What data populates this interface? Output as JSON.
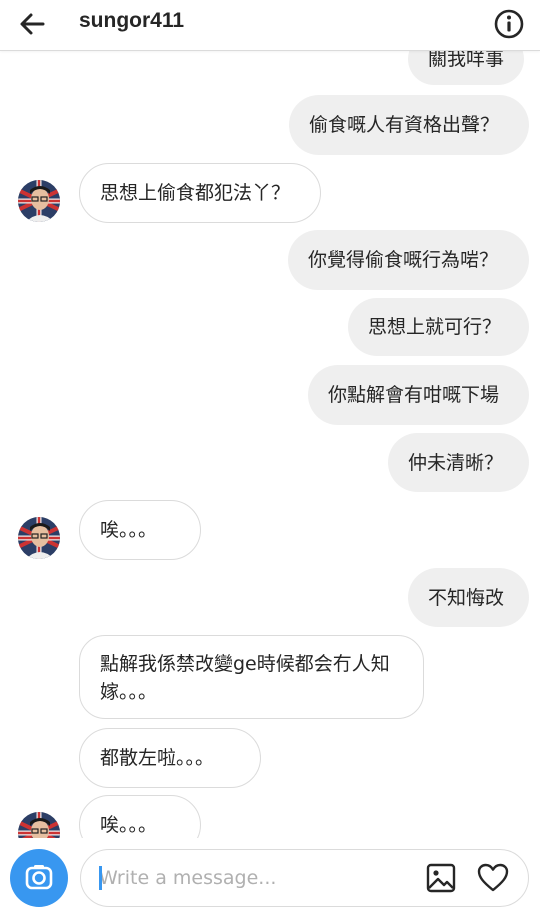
{
  "header": {
    "username": "sungor411",
    "back_icon": "arrow-left-icon",
    "info_icon": "info-icon"
  },
  "messages": [
    {
      "side": "out",
      "text": "關我咩事"
    },
    {
      "side": "out",
      "text": "偷食嘅人有資格出聲？"
    },
    {
      "side": "in",
      "text": "思想上偷食都犯法丫？",
      "avatar": true
    },
    {
      "side": "out",
      "text": "你覺得偷食嘅行為啱？"
    },
    {
      "side": "out",
      "text": "思想上就可行？"
    },
    {
      "side": "out",
      "text": "你點解會有咁嘅下場"
    },
    {
      "side": "out",
      "text": "仲未清晰？"
    },
    {
      "side": "in",
      "text": "唉。。。",
      "avatar": true
    },
    {
      "side": "out",
      "text": "不知悔改"
    },
    {
      "side": "in",
      "text": "點解我係禁改變ge時候都会冇人知嫁。。。"
    },
    {
      "side": "in",
      "text": "都散左啦。。。"
    },
    {
      "side": "in",
      "text": "唉。。。",
      "avatar": true
    }
  ],
  "composer": {
    "placeholder": "Write a message...",
    "camera_icon": "camera-icon",
    "gallery_icon": "gallery-icon",
    "heart_icon": "heart-icon"
  },
  "colors": {
    "accent": "#3897f0",
    "outgoing_bubble": "#efefef",
    "incoming_border": "#dbdbdb",
    "text": "#262626"
  }
}
